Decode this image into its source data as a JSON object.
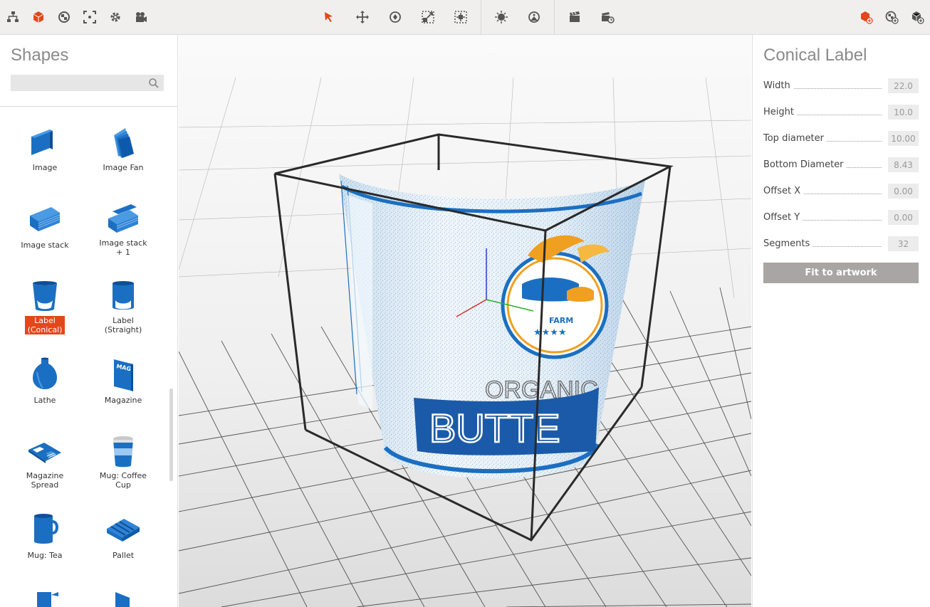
{
  "toolbar": {
    "left_icons": [
      "hierarchy-icon",
      "cube-icon",
      "material-ball-icon",
      "frame-icon",
      "gear-icon",
      "camera-icon"
    ],
    "center_icons": [
      "select-arrow-icon",
      "move-icon",
      "rotate-icon",
      "scale-icon",
      "align-icon"
    ],
    "light_icons": [
      "light-bulb-icon",
      "environment-icon"
    ],
    "render_icons": [
      "clapper-icon",
      "render-queue-icon"
    ],
    "right_icons": [
      "add-shape-icon",
      "add-material-icon",
      "add-object-icon"
    ],
    "accent_color": "#e2481b"
  },
  "shapes_panel": {
    "title": "Shapes",
    "search_placeholder": "",
    "items": [
      {
        "label": "Image",
        "icon": "image-icon"
      },
      {
        "label": "Image Fan",
        "icon": "image-fan-icon"
      },
      {
        "label": "Image stack",
        "icon": "image-stack-icon"
      },
      {
        "label": "Image stack\n+ 1",
        "icon": "image-stack-plus-icon"
      },
      {
        "label": "Label\n(Conical)",
        "icon": "label-conical-icon",
        "active": true
      },
      {
        "label": "Label\n(Straight)",
        "icon": "label-straight-icon"
      },
      {
        "label": "Lathe",
        "icon": "lathe-icon"
      },
      {
        "label": "Magazine",
        "icon": "magazine-icon"
      },
      {
        "label": "Magazine\nSpread",
        "icon": "magazine-spread-icon"
      },
      {
        "label": "Mug: Coffee\nCup",
        "icon": "coffee-cup-icon"
      },
      {
        "label": "Mug: Tea",
        "icon": "tea-mug-icon"
      },
      {
        "label": "Pallet",
        "icon": "pallet-icon"
      }
    ]
  },
  "viewport": {
    "label_text_top": "ORGANIC",
    "label_text_main": "BUTTE",
    "logo_text": "FARM"
  },
  "properties": {
    "title": "Conical Label",
    "rows": [
      {
        "label": "Width",
        "value": "22.0"
      },
      {
        "label": "Height",
        "value": "10.0"
      },
      {
        "label": "Top diameter",
        "value": "10.00"
      },
      {
        "label": "Bottom Diameter",
        "value": "8.43"
      },
      {
        "label": "Offset X",
        "value": "0.00"
      },
      {
        "label": "Offset Y",
        "value": "0.00"
      },
      {
        "label": "Segments",
        "value": "32"
      }
    ],
    "fit_button": "Fit to artwork"
  }
}
